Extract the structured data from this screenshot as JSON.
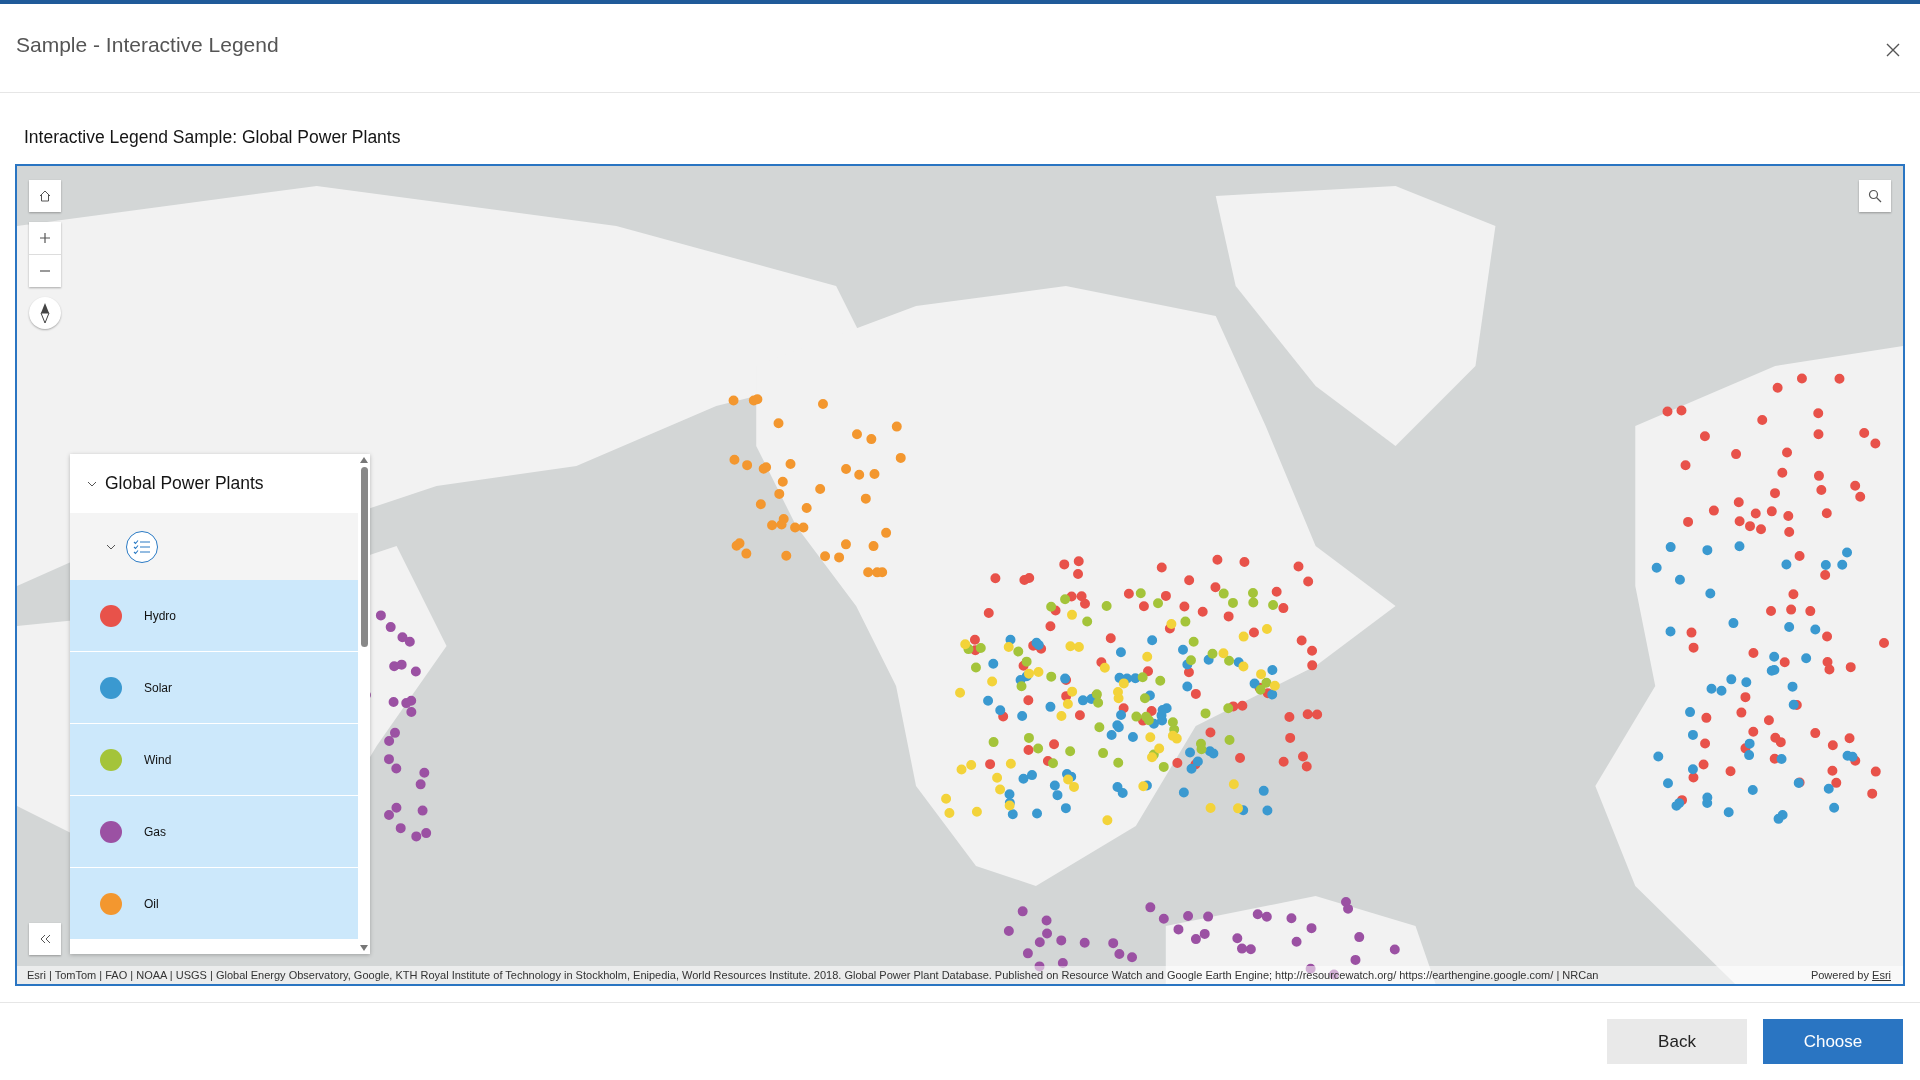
{
  "dialog": {
    "title": "Sample - Interactive Legend"
  },
  "sample": {
    "title": "Interactive Legend Sample: Global Power Plants"
  },
  "map": {
    "kind": "picture",
    "legend": {
      "layer_title": "Global Power Plants",
      "expanded": true,
      "items": [
        {
          "label": "Hydro",
          "color": "#e8524a",
          "selected": true
        },
        {
          "label": "Solar",
          "color": "#3a99d0",
          "selected": true
        },
        {
          "label": "Wind",
          "color": "#a4c43a",
          "selected": true
        },
        {
          "label": "Gas",
          "color": "#9b51a3",
          "selected": true
        },
        {
          "label": "Oil",
          "color": "#f3972f",
          "selected": true
        }
      ]
    },
    "attribution": "Esri | TomTom | FAO | NOAA | USGS | Global Energy Observatory, Google, KTH Royal Institute of Technology in Stockholm, Enipedia, World Resources Institute. 2018. Global Power Plant Database. Published on Resource Watch and Google Earth Engine; http://resourcewatch.org/ https://earthengine.google.com/ | NRCan",
    "powered_by": "Powered by",
    "powered_link": "Esri"
  },
  "buttons": [
    "Back",
    "Choose"
  ]
}
